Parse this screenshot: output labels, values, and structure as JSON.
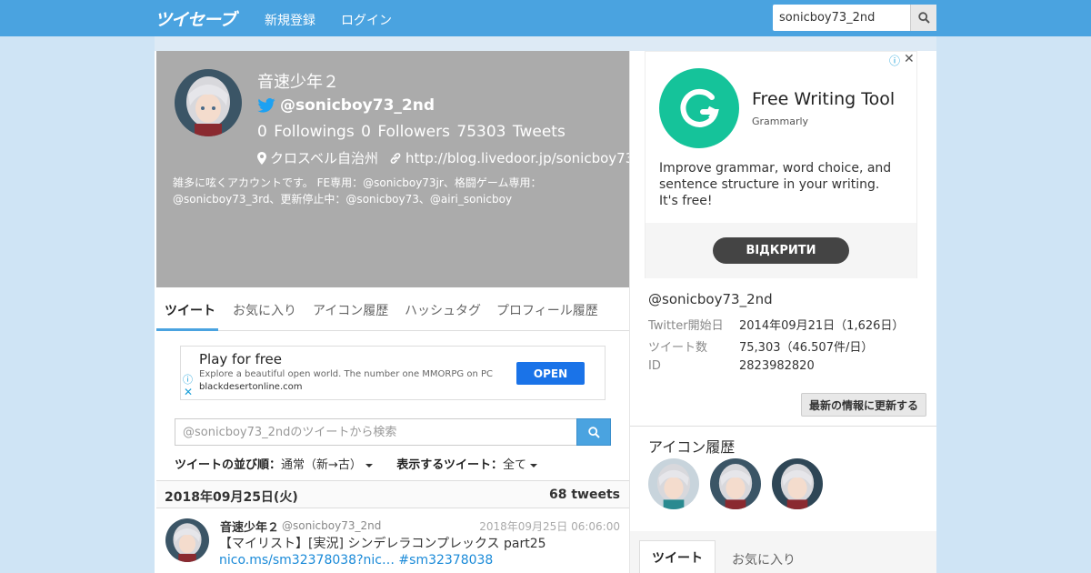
{
  "header": {
    "logo": "ツイセーブ",
    "nav": {
      "register": "新規登録",
      "login": "ログイン"
    },
    "search_value": "sonicboy73_2nd"
  },
  "profile": {
    "name": "音速少年２",
    "handle": "@sonicboy73_2nd",
    "followings_count": "0",
    "followings_label": "Followings",
    "followers_count": "0",
    "followers_label": "Followers",
    "tweets_count": "75303",
    "tweets_label": "Tweets",
    "location": "クロスベル自治州",
    "url": "http://blog.livedoor.jp/sonicboy73",
    "bio": "雑多に呟くアカウントです。 FE専用：@sonicboy73jr、格闘ゲーム専用：@sonicboy73_3rd、更新停止中：@sonicboy73、@airi_sonicboy"
  },
  "tabs": [
    "ツイート",
    "お気に入り",
    "アイコン履歴",
    "ハッシュタグ",
    "プロフィール履歴"
  ],
  "ad_banner": {
    "title": "Play for free",
    "description": "Explore a beautiful open world. The number one MMORPG on PC",
    "domain": "blackdesertonline.com",
    "button": "OPEN"
  },
  "tweet_search": {
    "placeholder": "@sonicboy73_2ndのツイートから検索"
  },
  "sort": {
    "order_label": "ツイートの並び順：",
    "order_value": "通常（新→古）",
    "filter_label": "表示するツイート：",
    "filter_value": "全て"
  },
  "date_group": {
    "date": "2018年09月25日(火)",
    "count": "68 tweets"
  },
  "tweet": {
    "name": "音速少年２",
    "handle": "@sonicboy73_2nd",
    "time": "2018年09月25日 06:06:00",
    "text": "【マイリスト】[実況] シンデレラコンプレックス part25 ",
    "link": "nico.ms/sm32378038?nic…",
    "hashtag": "#sm32378038"
  },
  "ad_side": {
    "title": "Free Writing Tool",
    "brand": "Grammarly",
    "description": "Improve grammar, word choice, and sentence structure in your writing. It's free!",
    "button": "ВІДКРИТИ"
  },
  "account_info": {
    "handle": "@sonicboy73_2nd",
    "rows": [
      {
        "label": "Twitter開始日",
        "value": "2014年09月21日（1,626日）"
      },
      {
        "label": "ツイート数",
        "value": "75,303（46.507件/日）"
      },
      {
        "label": "ID",
        "value": "2823982820"
      }
    ],
    "refresh_button": "最新の情報に更新する"
  },
  "icon_history": {
    "title": "アイコン履歴"
  },
  "side_tabs": [
    "ツイート",
    "お気に入り"
  ],
  "colors": {
    "accent": "#4aa3e0",
    "header_bg": "#ababab",
    "link": "#1a8ad8",
    "grammarly": "#15c39a"
  }
}
